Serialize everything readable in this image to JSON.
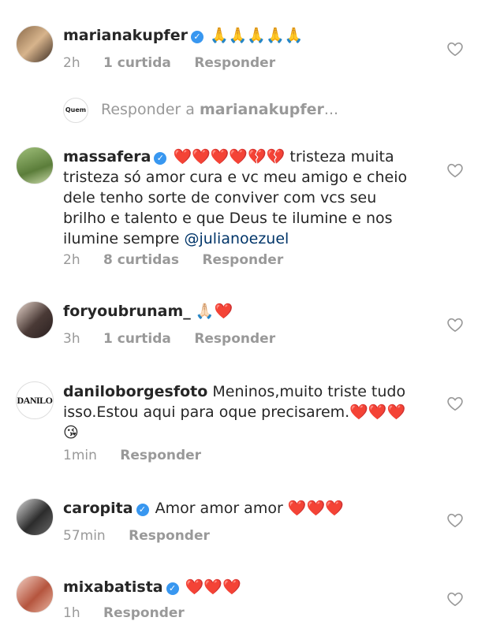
{
  "comments": [
    {
      "username": "marianakupfer",
      "verified": true,
      "text": "🙏🙏🙏🙏🙏",
      "time": "2h",
      "likes": "1 curtida",
      "reply": "Responder"
    },
    {
      "username": "massafera",
      "verified": true,
      "text": "❤️❤️❤️❤️💔💔 tristeza muita tristeza só amor cura e vc meu amigo e cheio dele tenho sorte de conviver com vcs seu brilho e talento e que Deus te ilumine e nos ilumine sempre ",
      "mention": "@julianoezuel",
      "time": "2h",
      "likes": "8 curtidas",
      "reply": "Responder"
    },
    {
      "username": "foryoubrunam_",
      "verified": false,
      "text": "🙏🏻❤️",
      "time": "3h",
      "likes": "1 curtida",
      "reply": "Responder"
    },
    {
      "username": "daniloborgesfoto",
      "verified": false,
      "text": "Meninos,muito triste tudo isso.Estou aqui para oque precisarem.❤️❤️❤️😘",
      "time": "1min",
      "reply": "Responder",
      "avatar_text": "DANILO"
    },
    {
      "username": "caropita",
      "verified": true,
      "text": "Amor amor amor ❤️❤️❤️",
      "time": "57min",
      "reply": "Responder"
    },
    {
      "username": "mixabatista",
      "verified": true,
      "text": "❤️❤️❤️",
      "time": "1h",
      "reply": "Responder"
    }
  ],
  "reply_prompt": {
    "prefix": "Responder a ",
    "target": "marianakupfer",
    "suffix": "...",
    "avatar_text": "Quem"
  },
  "colors": {
    "meta": "#999999",
    "verified": "#3897f0",
    "mention": "#003569"
  }
}
